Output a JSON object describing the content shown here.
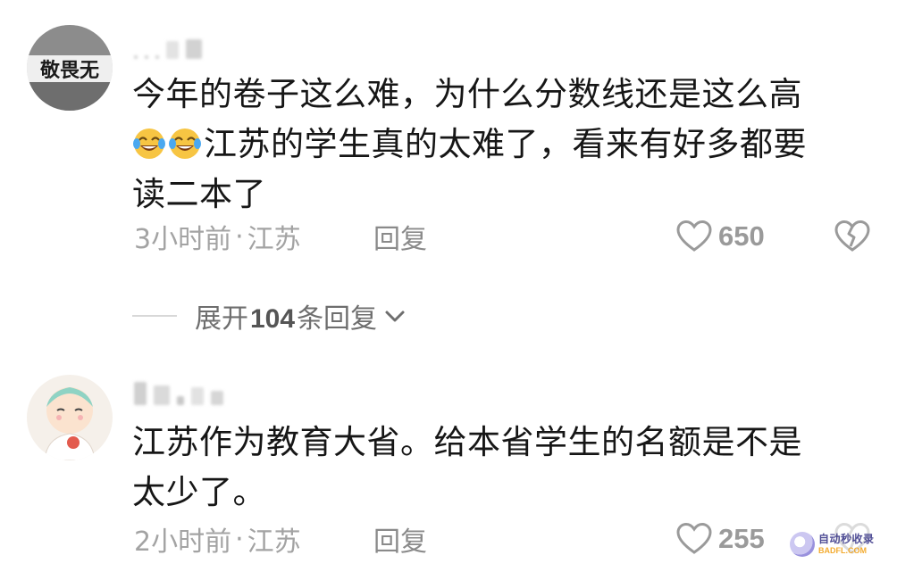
{
  "comments": [
    {
      "text_line1": "今年的卷子这么难，为什么分数线还是这么高",
      "text_line2": "江苏的学生真的太难了，看来有好多都要",
      "text_line3": "读二本了",
      "emoji_icon": "face-with-tears-of-joy-icon",
      "time": "3小时前",
      "separator": "·",
      "location": "江苏",
      "reply_label": "回复",
      "likes": "650",
      "avatar_text": "敬畏无"
    },
    {
      "text_line1": "江苏作为教育大省。给本省学生的名额是不是",
      "text_line2": "太少了。",
      "time": "2小时前",
      "separator": "·",
      "location": "江苏",
      "reply_label": "回复",
      "likes": "255"
    }
  ],
  "expand_replies": {
    "prefix": "展开",
    "count": "104",
    "suffix": "条回复"
  },
  "watermark": {
    "cn": "自动秒收录",
    "en": "BADFL.COM"
  },
  "colors": {
    "meta_gray": "#a3a3a3",
    "text": "#161616",
    "blur": "#d9d9d9"
  }
}
